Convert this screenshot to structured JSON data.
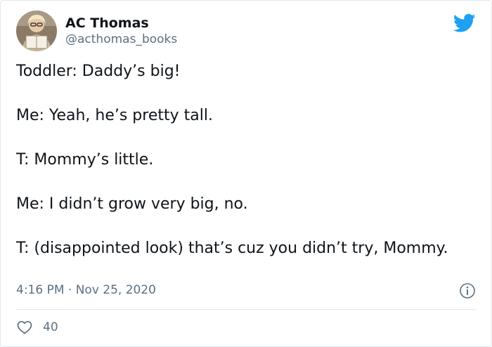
{
  "author": {
    "display_name": "AC Thomas",
    "handle": "@acthomas_books",
    "avatar_icon": "avatar-photo"
  },
  "brand": {
    "icon": "twitter-bird-icon",
    "color": "#1da1f2"
  },
  "tweet": {
    "lines": [
      "Toddler: Daddy’s big!",
      "Me: Yeah, he’s pretty tall.",
      "T: Mommy’s little.",
      "Me: I didn’t grow very big, no.",
      "T: (disappointed look) that’s cuz you didn’t try, Mommy."
    ]
  },
  "meta": {
    "timestamp": "4:16 PM · Nov 25, 2020",
    "info_icon": "info-icon"
  },
  "actions": {
    "like_icon": "heart-icon",
    "like_count": "40"
  },
  "colors": {
    "text": "#0f1419",
    "secondary": "#5b7083",
    "border": "#e1e8ed"
  }
}
